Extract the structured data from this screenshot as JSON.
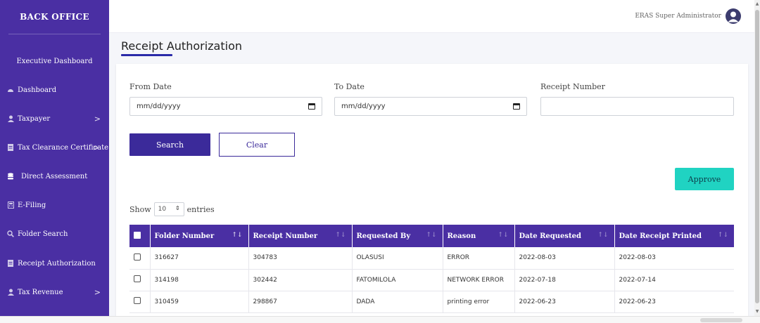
{
  "sidebar": {
    "brand": "BACK OFFICE",
    "top_item": "Executive Dashboard",
    "items": [
      {
        "label": "Dashboard",
        "icon": "gauge-icon",
        "chevron": false
      },
      {
        "label": "Taxpayer",
        "icon": "user-icon",
        "chevron": true
      },
      {
        "label": "Tax Clearance Certificate",
        "icon": "document-icon",
        "chevron": true
      },
      {
        "label": "Direct Assessment",
        "icon": "database-icon",
        "chevron": false
      },
      {
        "label": "E-Filing",
        "icon": "calculator-icon",
        "chevron": false
      },
      {
        "label": "Folder Search",
        "icon": "search-icon",
        "chevron": false
      },
      {
        "label": "Receipt Authorization",
        "icon": "document-icon",
        "chevron": false
      },
      {
        "label": "Tax Revenue",
        "icon": "user-icon",
        "chevron": true
      }
    ]
  },
  "header": {
    "user_name": "ERAS Super Administrator"
  },
  "page": {
    "title": "Receipt Authorization"
  },
  "filters": {
    "from_date_label": "From Date",
    "from_date_value": "mm/dd/yyyy",
    "to_date_label": "To Date",
    "to_date_value": "mm/dd/yyyy",
    "receipt_number_label": "Receipt Number",
    "receipt_number_value": "",
    "search_label": "Search",
    "clear_label": "Clear"
  },
  "actions": {
    "approve_label": "Approve"
  },
  "entries": {
    "show_label": "Show",
    "value": "10",
    "entries_label": "entries"
  },
  "table": {
    "columns": [
      "Folder Number",
      "Receipt Number",
      "Requested By",
      "Reason",
      "Date Requested",
      "Date Receipt Printed"
    ],
    "rows": [
      [
        "316627",
        "304783",
        "OLASUSI",
        "ERROR",
        "2022-08-03",
        "2022-08-03"
      ],
      [
        "314198",
        "302442",
        "FATOMILOLA",
        "NETWORK ERROR",
        "2022-07-18",
        "2022-07-14"
      ],
      [
        "310459",
        "298867",
        "DADA",
        "printing error",
        "2022-06-23",
        "2022-06-23"
      ]
    ]
  },
  "colors": {
    "sidebar": "#4a2fa3",
    "primary_button": "#3b2a9a",
    "approve_button": "#20d3c2",
    "title_underline": "#2a2aa8"
  }
}
